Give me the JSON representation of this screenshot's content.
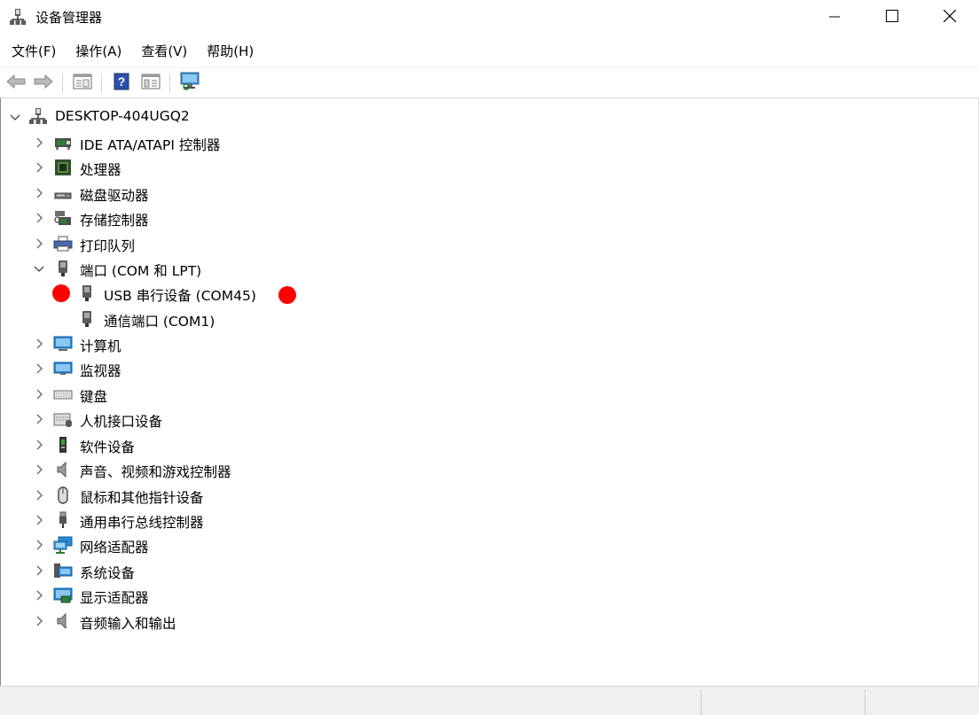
{
  "window": {
    "title": "设备管理器"
  },
  "menu": [
    "文件(F)",
    "操作(A)",
    "查看(V)",
    "帮助(H)"
  ],
  "toolbar": [
    "back-icon",
    "forward-icon",
    "properties-view-icon",
    "help-icon",
    "panel-view-icon",
    "scan-monitor-icon"
  ],
  "tree": {
    "root": "DESKTOP-404UGQ2",
    "categories": [
      {
        "label": "IDE ATA/ATAPI 控制器",
        "icon": "ide-controller-icon"
      },
      {
        "label": "处理器",
        "icon": "processor-icon"
      },
      {
        "label": "磁盘驱动器",
        "icon": "disk-drive-icon"
      },
      {
        "label": "存储控制器",
        "icon": "storage-controller-icon"
      },
      {
        "label": "打印队列",
        "icon": "printer-icon"
      },
      {
        "label": "端口 (COM 和 LPT)",
        "icon": "port-icon",
        "expanded": true,
        "children": [
          {
            "label": "USB 串行设备 (COM45)",
            "icon": "port-icon",
            "highlighted": true
          },
          {
            "label": "通信端口 (COM1)",
            "icon": "port-icon"
          }
        ]
      },
      {
        "label": "计算机",
        "icon": "computer-icon"
      },
      {
        "label": "监视器",
        "icon": "monitor-icon"
      },
      {
        "label": "键盘",
        "icon": "keyboard-icon"
      },
      {
        "label": "人机接口设备",
        "icon": "hid-icon"
      },
      {
        "label": "软件设备",
        "icon": "software-device-icon"
      },
      {
        "label": "声音、视频和游戏控制器",
        "icon": "speaker-icon"
      },
      {
        "label": "鼠标和其他指针设备",
        "icon": "mouse-icon"
      },
      {
        "label": "通用串行总线控制器",
        "icon": "usb-icon"
      },
      {
        "label": "网络适配器",
        "icon": "network-adapter-icon"
      },
      {
        "label": "系统设备",
        "icon": "system-device-icon"
      },
      {
        "label": "显示适配器",
        "icon": "display-adapter-icon"
      },
      {
        "label": "音频输入和输出",
        "icon": "audio-io-icon"
      }
    ]
  },
  "colors": {
    "marker": "#ff0000",
    "statusbar": "#f0f0f0"
  }
}
